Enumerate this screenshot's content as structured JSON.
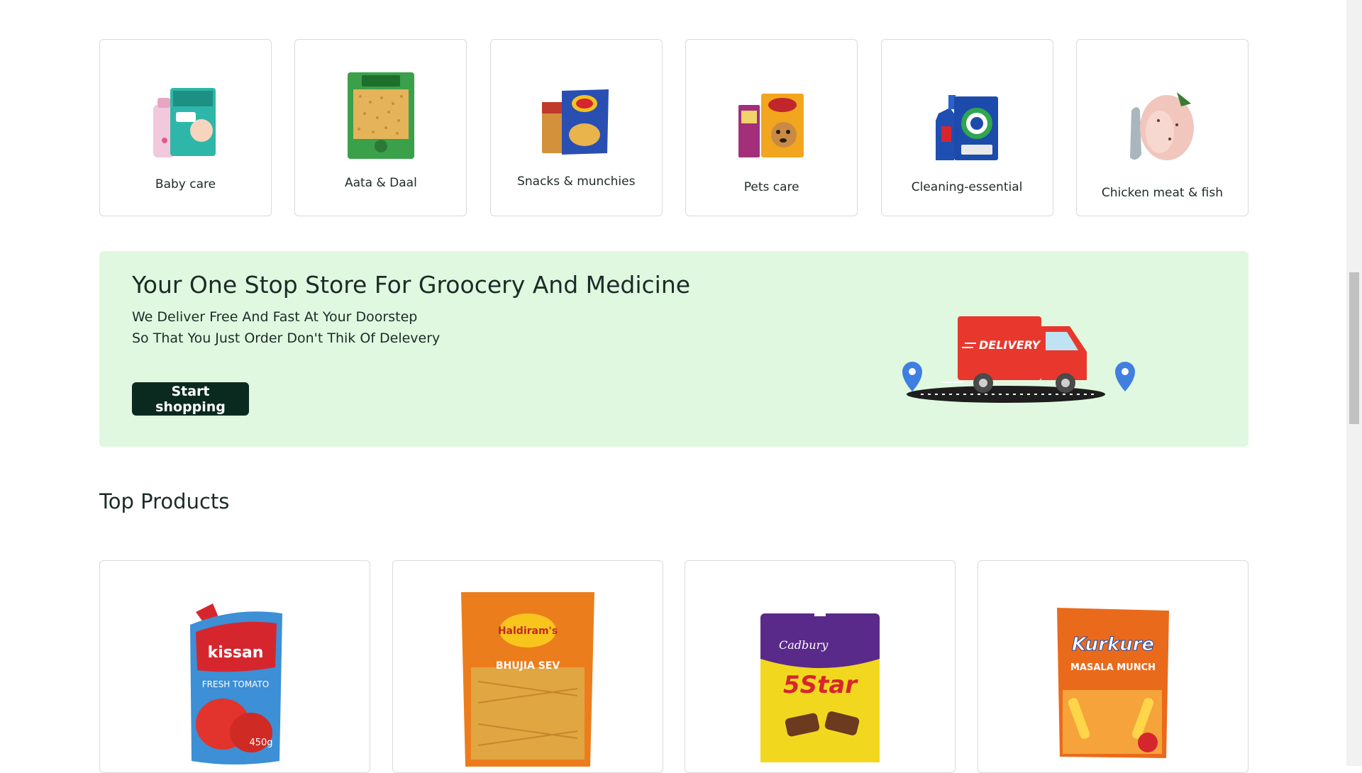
{
  "categories": [
    {
      "label": "Baby care",
      "icon": "baby-care-products-icon"
    },
    {
      "label": "Aata & Daal",
      "icon": "aata-daal-pack-icon"
    },
    {
      "label": "Snacks & munchies",
      "icon": "snacks-pack-icon"
    },
    {
      "label": "Pets care",
      "icon": "pet-food-icon"
    },
    {
      "label": "Cleaning-essential",
      "icon": "cleaning-products-icon"
    },
    {
      "label": "Chicken meat & fish",
      "icon": "chicken-fish-icon"
    }
  ],
  "banner": {
    "title": "Your One Stop Store For Groocery And Medicine",
    "line1": "We Deliver Free And Fast At Your Doorstep",
    "line2": "So That You Just Order Don't Thik Of Delevery",
    "button_label": "Start shopping",
    "truck_text": "DELIVERY",
    "colors": {
      "background": "#e0f8df",
      "button": "#0b2a1f",
      "truck": "#e8382d",
      "pin": "#3f7fe0"
    }
  },
  "top_products": {
    "title": "Top Products",
    "items": [
      {
        "icon": "kissan-ketchup-icon",
        "brand": "kissan",
        "subtitle": "FRESH TOMATO",
        "badge": "450g"
      },
      {
        "icon": "haldirams-bhujia-icon",
        "brand": "Haldiram's",
        "subtitle": "BHUJIA SEV"
      },
      {
        "icon": "cadbury-5star-icon",
        "brand": "Cadbury",
        "subtitle": "5Star"
      },
      {
        "icon": "kurkure-icon",
        "brand": "Kurkure",
        "subtitle": "MASALA MUNCH"
      }
    ]
  }
}
